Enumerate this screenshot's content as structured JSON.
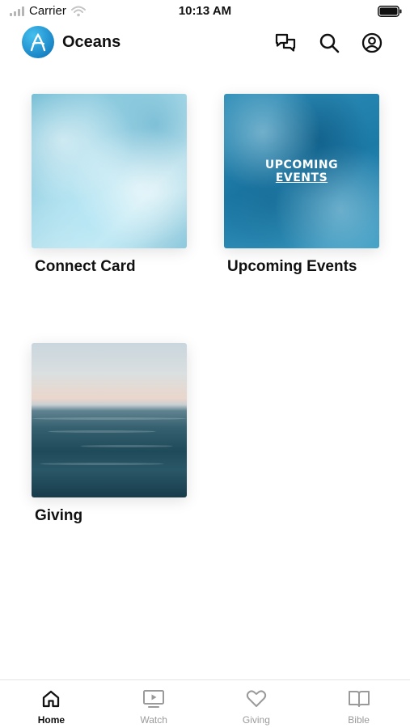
{
  "status_bar": {
    "carrier": "Carrier",
    "time": "10:13 AM"
  },
  "header": {
    "title": "Oceans",
    "logo_icon": "app-logo-icon",
    "actions": [
      "chat-icon",
      "search-icon",
      "profile-icon"
    ]
  },
  "tiles": [
    {
      "title": "Connect Card"
    },
    {
      "title": "Upcoming Events",
      "image_text_line1": "UPCOMING",
      "image_text_line2": "EVENTS"
    },
    {
      "title": "Giving"
    }
  ],
  "tab_bar": {
    "items": [
      {
        "label": "Home",
        "icon": "home-icon",
        "active": true
      },
      {
        "label": "Watch",
        "icon": "watch-icon",
        "active": false
      },
      {
        "label": "Giving",
        "icon": "heart-icon",
        "active": false
      },
      {
        "label": "Bible",
        "icon": "book-icon",
        "active": false
      }
    ]
  },
  "colors": {
    "accent": "#1a86c7",
    "text": "#111111",
    "inactive": "#9a9a9a"
  }
}
